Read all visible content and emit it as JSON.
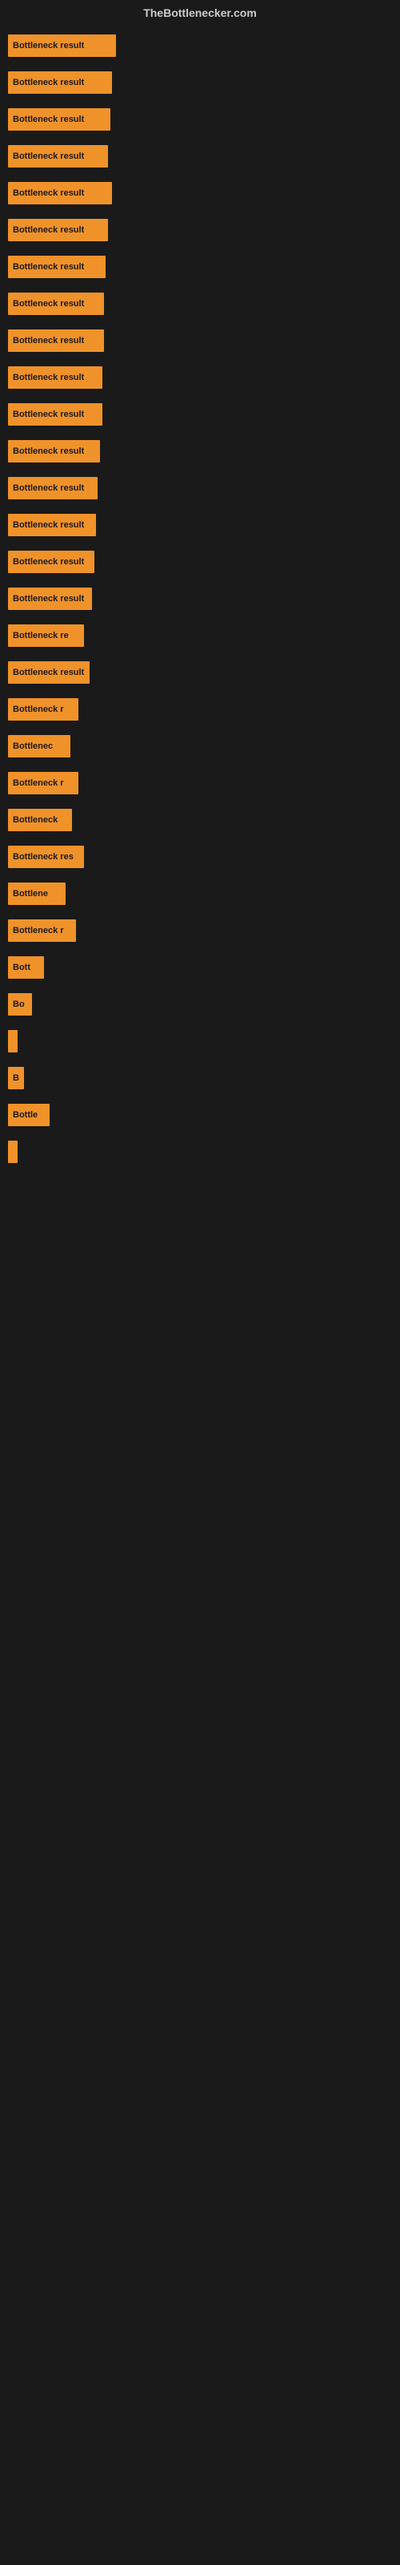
{
  "header": {
    "title": "TheBottlenecker.com"
  },
  "bars": [
    {
      "label": "Bottleneck result",
      "width": 135
    },
    {
      "label": "Bottleneck result",
      "width": 130
    },
    {
      "label": "Bottleneck result",
      "width": 128
    },
    {
      "label": "Bottleneck result",
      "width": 125
    },
    {
      "label": "Bottleneck result",
      "width": 130
    },
    {
      "label": "Bottleneck result",
      "width": 125
    },
    {
      "label": "Bottleneck result",
      "width": 122
    },
    {
      "label": "Bottleneck result",
      "width": 120
    },
    {
      "label": "Bottleneck result",
      "width": 120
    },
    {
      "label": "Bottleneck result",
      "width": 118
    },
    {
      "label": "Bottleneck result",
      "width": 118
    },
    {
      "label": "Bottleneck result",
      "width": 115
    },
    {
      "label": "Bottleneck result",
      "width": 112
    },
    {
      "label": "Bottleneck result",
      "width": 110
    },
    {
      "label": "Bottleneck result",
      "width": 108
    },
    {
      "label": "Bottleneck result",
      "width": 105
    },
    {
      "label": "Bottleneck re",
      "width": 95
    },
    {
      "label": "Bottleneck result",
      "width": 102
    },
    {
      "label": "Bottleneck r",
      "width": 88
    },
    {
      "label": "Bottlenec",
      "width": 78
    },
    {
      "label": "Bottleneck r",
      "width": 88
    },
    {
      "label": "Bottleneck",
      "width": 80
    },
    {
      "label": "Bottleneck res",
      "width": 95
    },
    {
      "label": "Bottlene",
      "width": 72
    },
    {
      "label": "Bottleneck r",
      "width": 85
    },
    {
      "label": "Bott",
      "width": 45
    },
    {
      "label": "Bo",
      "width": 30
    },
    {
      "label": "|",
      "width": 8
    },
    {
      "label": "B",
      "width": 20
    },
    {
      "label": "Bottle",
      "width": 52
    },
    {
      "label": "|",
      "width": 6
    }
  ]
}
